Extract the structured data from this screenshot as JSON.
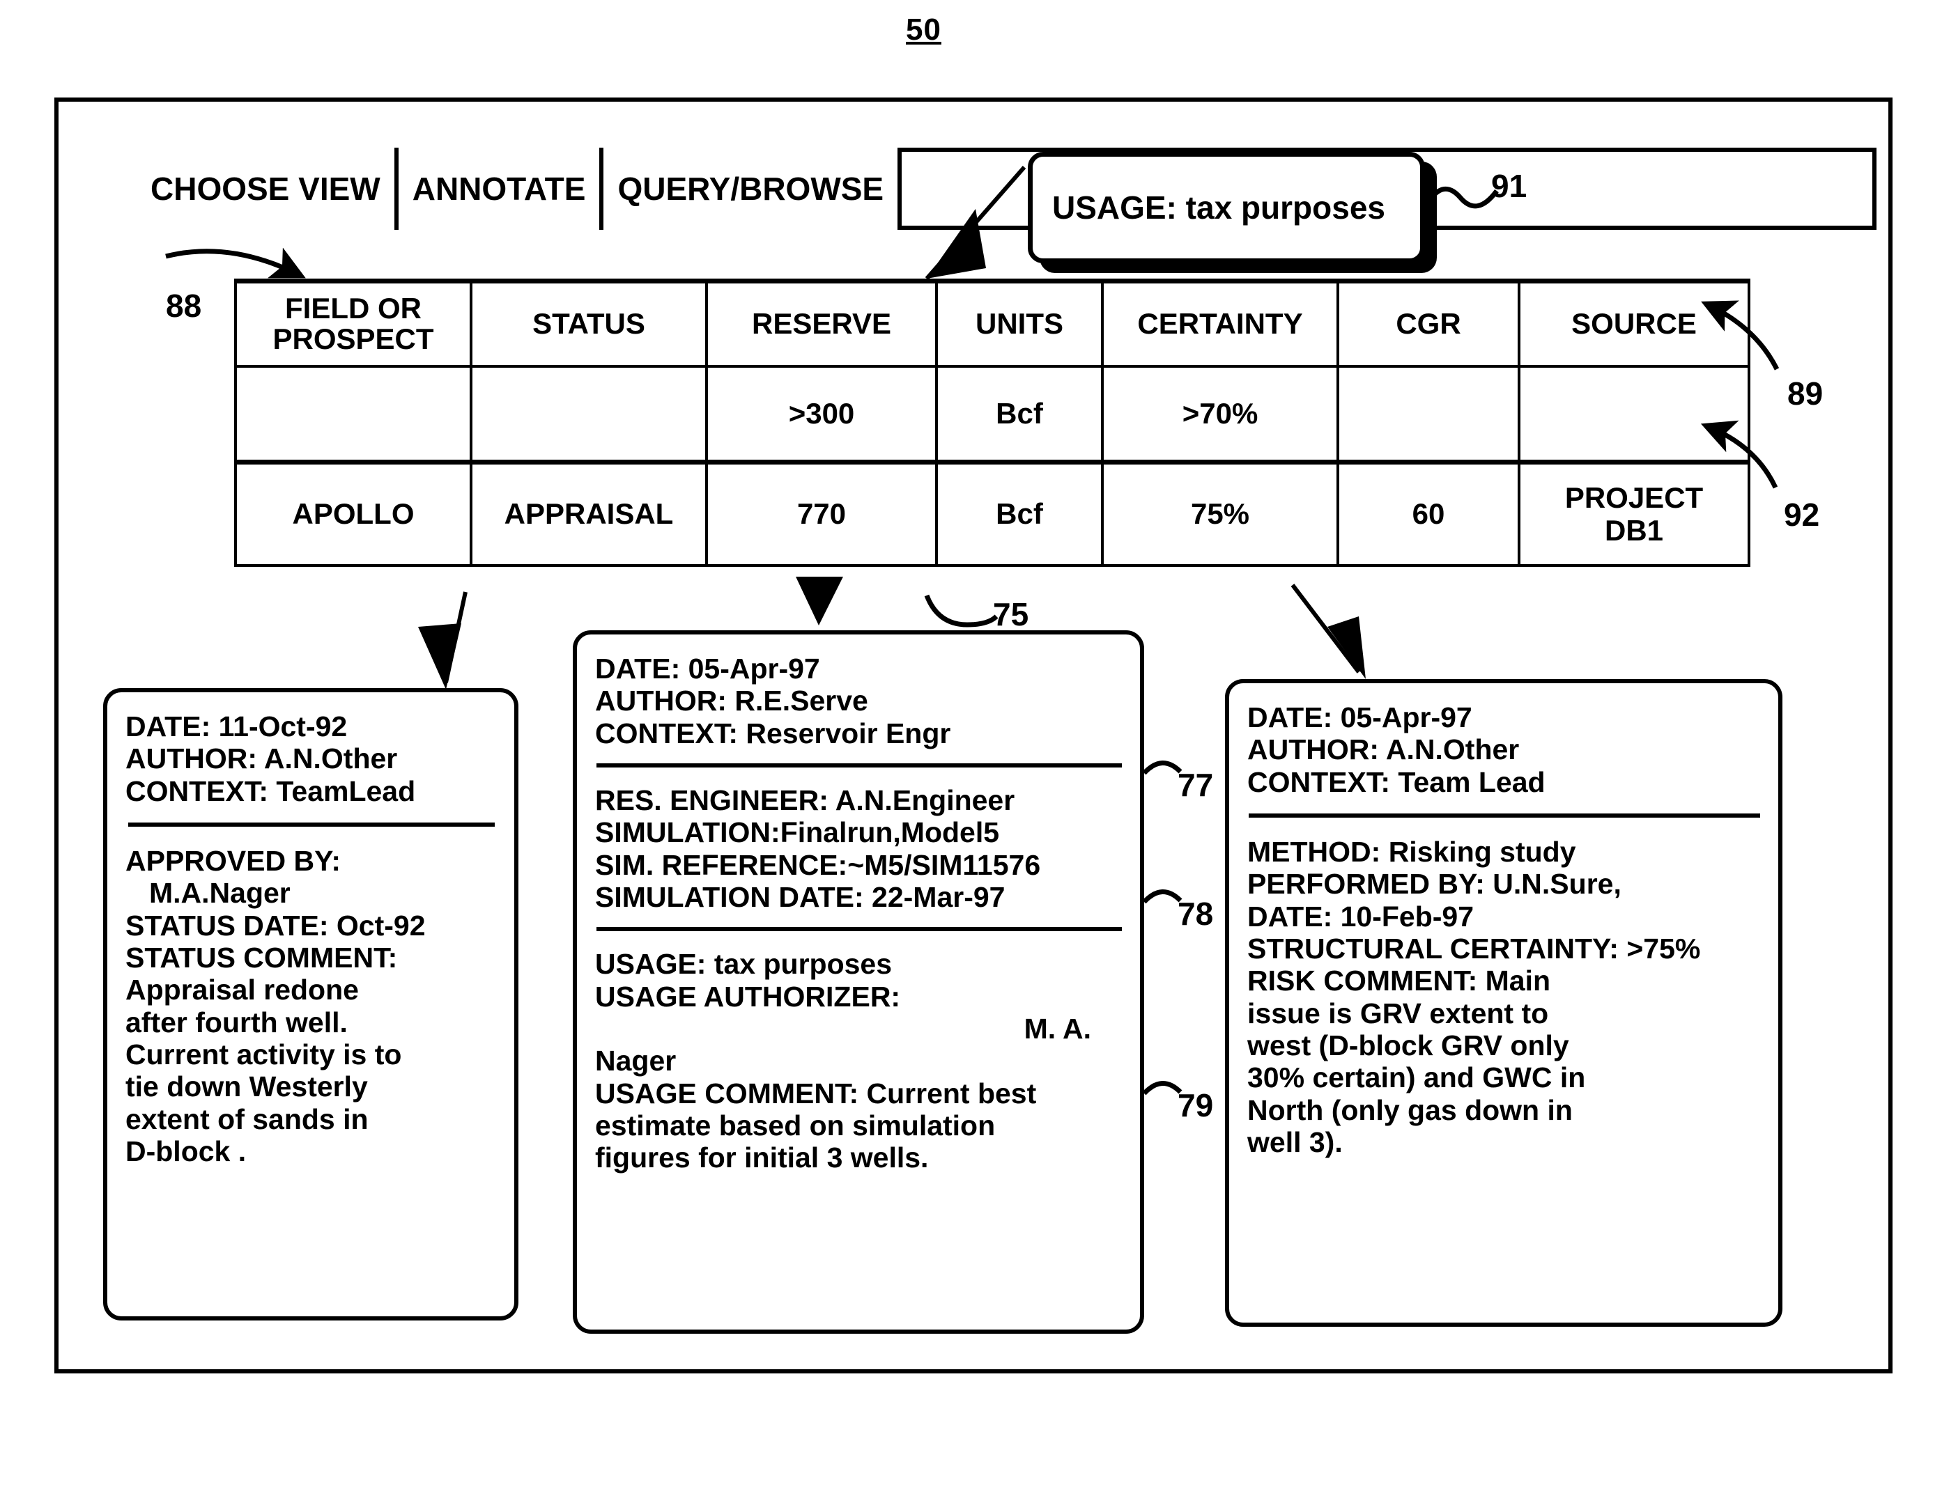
{
  "figure": {
    "number": "50"
  },
  "menubar": {
    "items": [
      {
        "label": "CHOOSE VIEW"
      },
      {
        "label": "ANNOTATE"
      },
      {
        "label": "QUERY/BROWSE"
      }
    ]
  },
  "usage_tooltip": {
    "text": "USAGE: tax purposes"
  },
  "table": {
    "headers": [
      "FIELD OR PROSPECT",
      "STATUS",
      "RESERVE",
      "UNITS",
      "CERTAINTY",
      "CGR",
      "SOURCE"
    ],
    "header_lines": [
      [
        "FIELD OR",
        "PROSPECT"
      ],
      [
        "STATUS"
      ],
      [
        "RESERVE"
      ],
      [
        "UNITS"
      ],
      [
        "CERTAINTY"
      ],
      [
        "CGR"
      ],
      [
        "SOURCE"
      ]
    ],
    "rows": [
      {
        "name": "query-row",
        "cells": [
          "",
          "",
          ">300",
          "Bcf",
          ">70%",
          "",
          ""
        ],
        "source_lines": [
          ""
        ]
      },
      {
        "name": "apollo-row",
        "cells": [
          "APOLLO",
          "APPRAISAL",
          "770",
          "Bcf",
          "75%",
          "60",
          "PROJECT DB1"
        ],
        "source_lines": [
          "PROJECT",
          "DB1"
        ]
      }
    ]
  },
  "reference_numerals": {
    "n88": "88",
    "n89": "89",
    "n91": "91",
    "n92": "92",
    "n75": "75",
    "n77": "77",
    "n78": "78",
    "n79": "79"
  },
  "annotations": {
    "left": {
      "header": [
        "DATE: 11-Oct-92",
        "AUTHOR: A.N.Other",
        "CONTEXT: TeamLead"
      ],
      "body": [
        "APPROVED BY:",
        "M.A.Nager",
        "STATUS DATE: Oct-92",
        "STATUS COMMENT:",
        "Appraisal redone",
        "after fourth well.",
        "Current activity is to",
        "tie down Westerly",
        "extent of sands in",
        "D-block ."
      ]
    },
    "middle": {
      "header": [
        "DATE: 05-Apr-97",
        "AUTHOR: R.E.Serve",
        "CONTEXT: Reservoir Engr"
      ],
      "section_78": [
        "RES. ENGINEER: A.N.Engineer",
        "SIMULATION:Finalrun,Model5",
        "SIM. REFERENCE:~M5/SIM11576",
        "SIMULATION DATE: 22-Mar-97"
      ],
      "section_79": [
        "USAGE: tax purposes",
        "USAGE AUTHORIZER:",
        "M. A.",
        "Nager",
        "USAGE COMMENT: Current best",
        "estimate based on simulation",
        "figures for initial 3 wells."
      ]
    },
    "right": {
      "header": [
        "DATE: 05-Apr-97",
        "AUTHOR: A.N.Other",
        "CONTEXT: Team Lead"
      ],
      "body": [
        "METHOD: Risking study",
        "PERFORMED BY: U.N.Sure,",
        "DATE: 10-Feb-97",
        "STRUCTURAL CERTAINTY: >75%",
        "RISK COMMENT: Main",
        "issue is GRV extent to",
        "west (D-block GRV only",
        "30% certain) and GWC in",
        "North (only gas down in",
        "well 3)."
      ]
    }
  },
  "colors": {
    "ink": "#000000",
    "paper": "#ffffff"
  }
}
